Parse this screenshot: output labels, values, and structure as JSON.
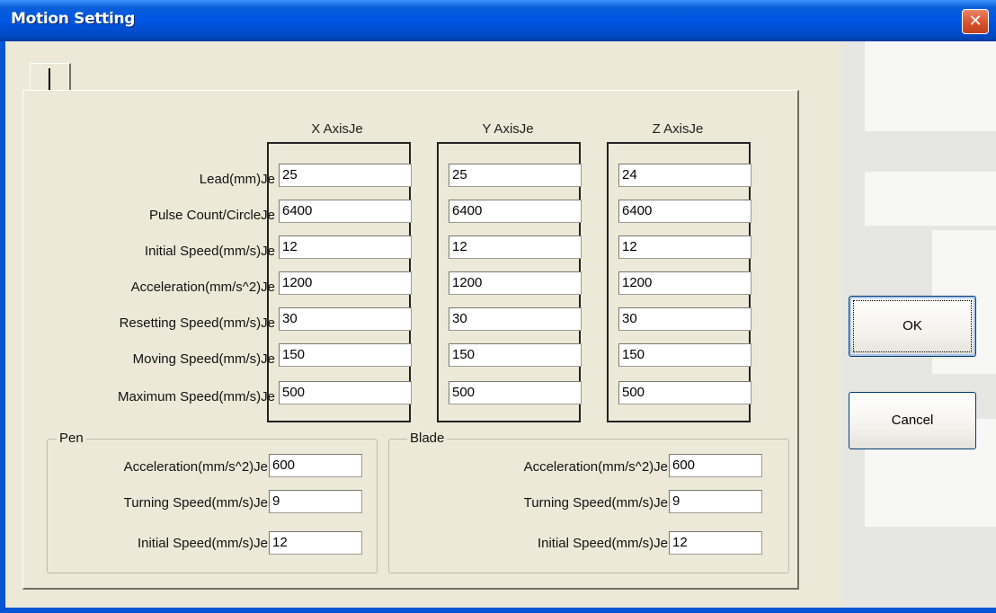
{
  "window": {
    "title": "Motion Setting",
    "close_symbol": "✕"
  },
  "axis_headers": [
    "X AxisJe",
    "Y AxisJe",
    "Z AxisJe"
  ],
  "rows": [
    {
      "label": "Lead(mm)Je",
      "values": [
        "25",
        "25",
        "24"
      ]
    },
    {
      "label": "Pulse Count/CircleJe",
      "values": [
        "6400",
        "6400",
        "6400"
      ]
    },
    {
      "label": "Initial Speed(mm/s)Je",
      "values": [
        "12",
        "12",
        "12"
      ]
    },
    {
      "label": "Acceleration(mm/s^2)Je",
      "values": [
        "1200",
        "1200",
        "1200"
      ]
    },
    {
      "label": "Resetting Speed(mm/s)Je",
      "values": [
        "30",
        "30",
        "30"
      ]
    },
    {
      "label": "Moving Speed(mm/s)Je",
      "values": [
        "150",
        "150",
        "150"
      ]
    },
    {
      "label": "Maximum Speed(mm/s)Je",
      "values": [
        "500",
        "500",
        "500"
      ]
    }
  ],
  "pen": {
    "title": "Pen",
    "rows": [
      {
        "label": "Acceleration(mm/s^2)Je",
        "value": "600"
      },
      {
        "label": "Turning Speed(mm/s)Je",
        "value": "9"
      },
      {
        "label": "Initial Speed(mm/s)Je",
        "value": "12"
      }
    ]
  },
  "blade": {
    "title": "Blade",
    "rows": [
      {
        "label": "Acceleration(mm/s^2)Je",
        "value": "600"
      },
      {
        "label": "Turning Speed(mm/s)Je",
        "value": "9"
      },
      {
        "label": "Initial Speed(mm/s)Je",
        "value": "12"
      }
    ]
  },
  "buttons": {
    "ok": "OK",
    "cancel": "Cancel"
  },
  "colors": {
    "titlebar": "#0055e3",
    "close": "#d9532c",
    "dialog_bg": "#ece9d8"
  }
}
